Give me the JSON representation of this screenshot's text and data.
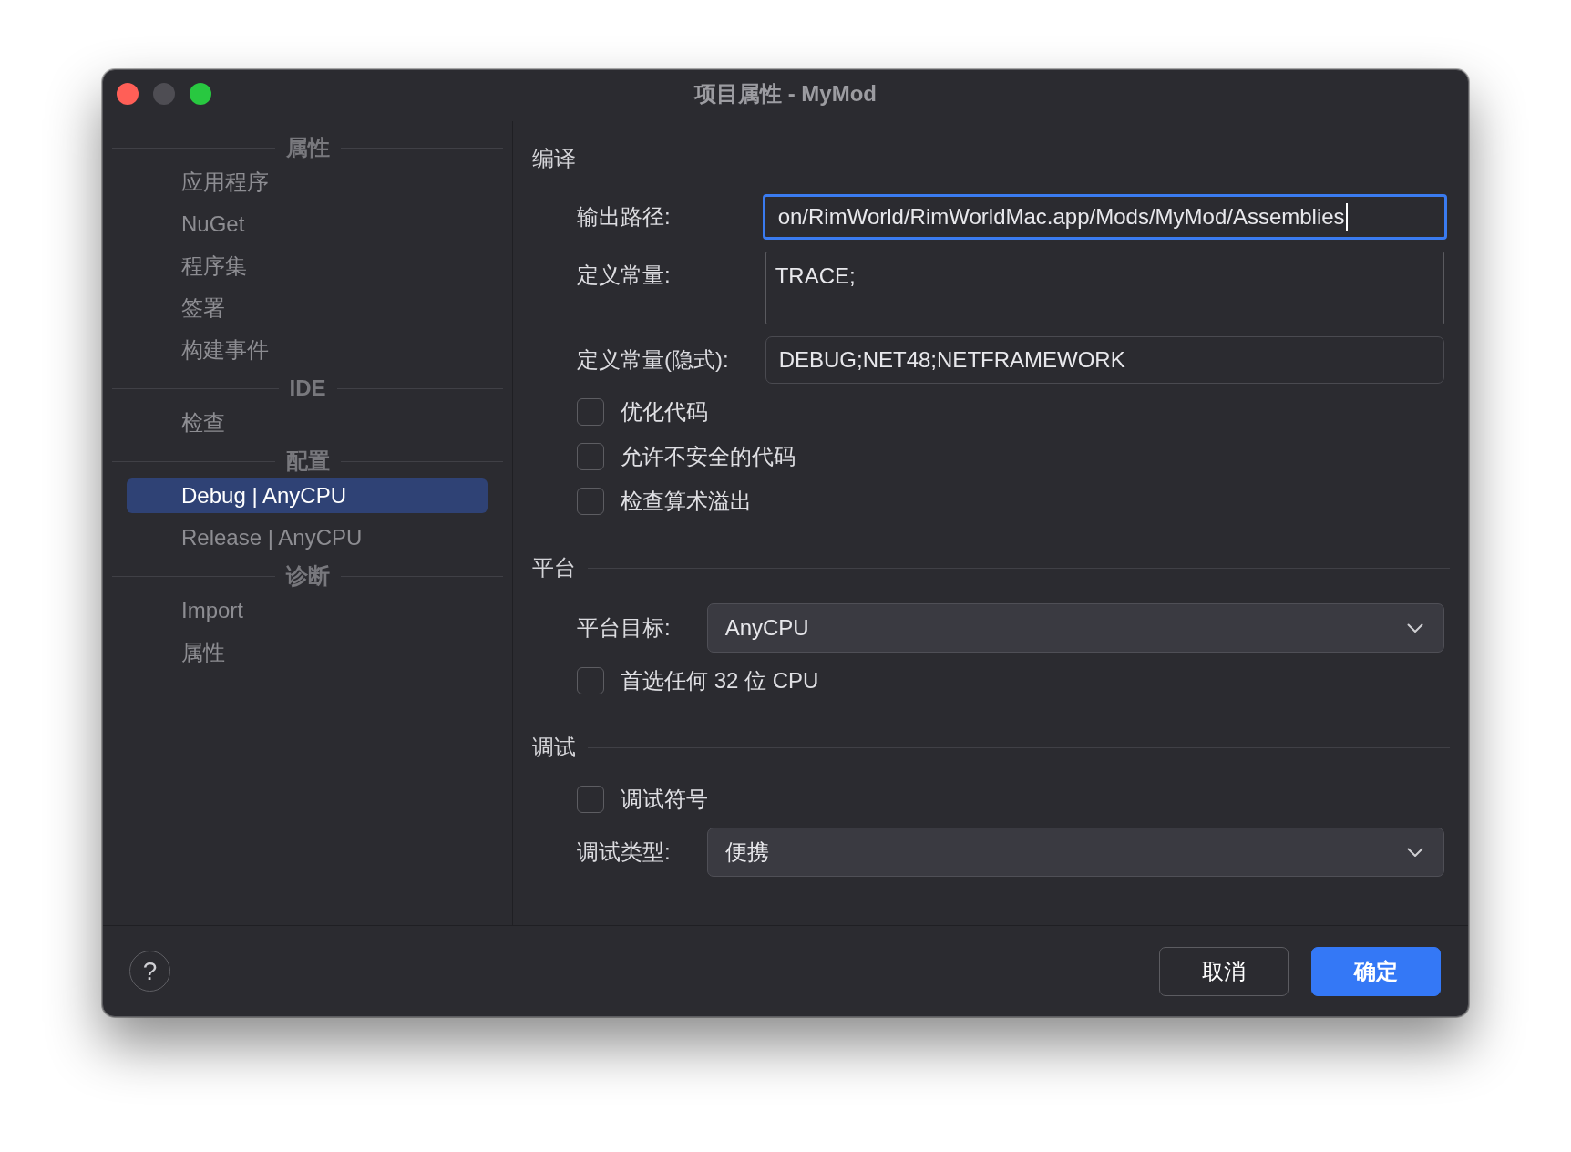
{
  "window": {
    "title": "项目属性 - MyMod",
    "controls": [
      {
        "kind": "close",
        "disabled": false
      },
      {
        "kind": "minimize",
        "disabled": true
      },
      {
        "kind": "zoom",
        "disabled": false
      }
    ]
  },
  "sidebar": {
    "groups": [
      {
        "title": "属性",
        "items": [
          {
            "label": "应用程序",
            "selected": false
          },
          {
            "label": "NuGet",
            "selected": false
          },
          {
            "label": "程序集",
            "selected": false
          },
          {
            "label": "签署",
            "selected": false
          },
          {
            "label": "构建事件",
            "selected": false
          }
        ]
      },
      {
        "title": "IDE",
        "items": [
          {
            "label": "检查",
            "selected": false
          }
        ]
      },
      {
        "title": "配置",
        "items": [
          {
            "label": "Debug | AnyCPU",
            "selected": true
          },
          {
            "label": "Release | AnyCPU",
            "selected": false
          }
        ]
      },
      {
        "title": "诊断",
        "items": [
          {
            "label": "Import",
            "selected": false
          },
          {
            "label": "属性",
            "selected": false
          }
        ]
      }
    ]
  },
  "sections": [
    {
      "title": "编译",
      "rows": [
        {
          "kind": "text",
          "label": "输出路径:",
          "value": "on/RimWorld/RimWorldMac.app/Mods/MyMod/Assemblies",
          "focused": true
        },
        {
          "kind": "multiline",
          "label": "定义常量:",
          "value": "TRACE;",
          "focused": false
        },
        {
          "kind": "text",
          "label": "定义常量(隐式):",
          "value": "DEBUG;NET48;NETFRAMEWORK",
          "focused": false
        },
        {
          "kind": "checkbox",
          "label": "优化代码",
          "checked": false
        },
        {
          "kind": "checkbox",
          "label": "允许不安全的代码",
          "checked": false
        },
        {
          "kind": "checkbox",
          "label": "检查算术溢出",
          "checked": false
        }
      ]
    },
    {
      "title": "平台",
      "rows": [
        {
          "kind": "select",
          "label": "平台目标:",
          "value": "AnyCPU"
        },
        {
          "kind": "checkbox",
          "label": "首选任何 32 位 CPU",
          "checked": false
        }
      ]
    },
    {
      "title": "调试",
      "rows": [
        {
          "kind": "checkbox",
          "label": "调试符号",
          "checked": false
        },
        {
          "kind": "select",
          "label": "调试类型:",
          "value": "便携"
        }
      ]
    }
  ],
  "footer": {
    "help": "?",
    "buttons": [
      {
        "label": "取消",
        "kind": "secondary"
      },
      {
        "label": "确定",
        "kind": "primary"
      }
    ]
  }
}
